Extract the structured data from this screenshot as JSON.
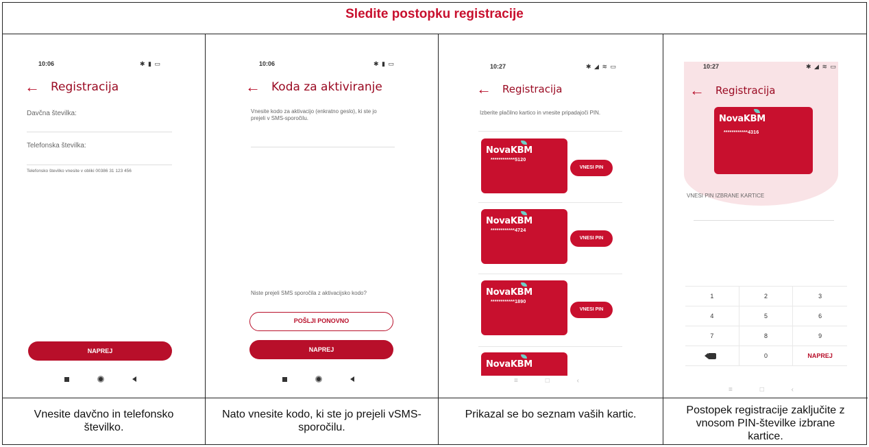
{
  "title": "Sledite postopku registracije",
  "colors": {
    "brand": "#c8102e",
    "frame": "#222222"
  },
  "steps": [
    {
      "status_time": "10:06",
      "app_title": "Registracija",
      "field1_label": "Davčna številka:",
      "field2_label": "Telefonska številka:",
      "helper": "Telefonsko številko vnesite v obliki 00386 31 123 456",
      "next_label": "NAPREJ",
      "caption": "Vnesite davčno in telefonsko številko."
    },
    {
      "status_time": "10:06",
      "app_title": "Koda za aktiviranje",
      "instruction": "Vnesite kodo za aktivacijo (enkratno geslo), ki ste jo prejeli v SMS-sporočilu.",
      "not_received": "Niste prejeli SMS sporočila z aktivacijsko kodo?",
      "resend_label": "POŠLJI PONOVNO",
      "next_label": "NAPREJ",
      "caption": "Nato vnesite kodo, ki ste jo prejeli vSMS-sporočilu."
    },
    {
      "status_time": "10:27",
      "app_title": "Registracija",
      "instruction": "Izberite plačilno kartico in vnesite pripadajoči PIN.",
      "brand": "NovaKBM",
      "pin_label": "VNESI PIN",
      "cards": [
        {
          "number": "************5120"
        },
        {
          "number": "************4724"
        },
        {
          "number": "************1890"
        },
        {
          "number": ""
        }
      ],
      "caption": "Prikazal se bo seznam vaših kartic."
    },
    {
      "status_time": "10:27",
      "app_title": "Registracija",
      "brand": "NovaKBM",
      "card_number": "************4316",
      "pin_prompt": "VNESI PIN IZBRANE KARTICE",
      "keys": [
        "1",
        "2",
        "3",
        "4",
        "5",
        "6",
        "7",
        "8",
        "9",
        "",
        "0",
        "NAPREJ"
      ],
      "caption": "Postopek registracije zaključite z vnosom PIN-številke izbrane kartice."
    }
  ]
}
